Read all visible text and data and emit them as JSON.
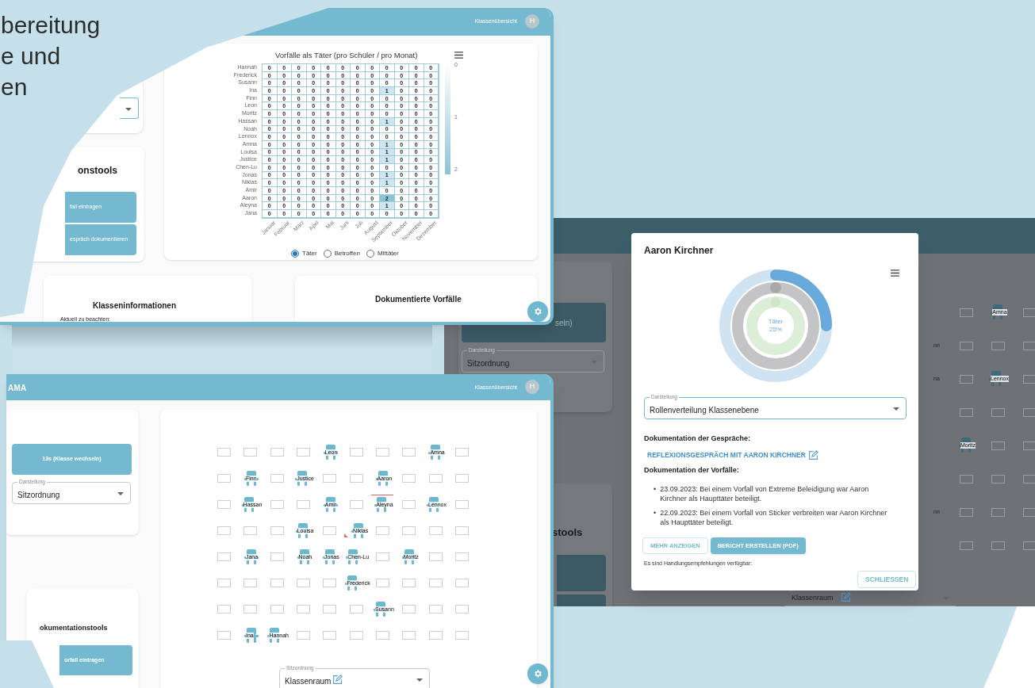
{
  "headline": {
    "lines": [
      "bereitung",
      "e und",
      "en"
    ]
  },
  "heatmap_window": {
    "header_link": "Klassenübersicht",
    "avatar": "H",
    "tools_card": {
      "title": "onstools",
      "buttons": [
        "fall eintragen",
        "espräch dokumentieren"
      ]
    },
    "chart": {
      "title": "Vorfälle als Täter (pro Schüler / pro Monat)",
      "months": [
        "Januar",
        "Februar",
        "März",
        "April",
        "Mai",
        "Juni",
        "Juli",
        "August",
        "September",
        "Oktober",
        "November",
        "Dezember"
      ],
      "scale": [
        "0",
        "1",
        "2"
      ],
      "rows": [
        {
          "name": "Hannah",
          "values": [
            "0",
            "0",
            "0",
            "0",
            "0",
            "0",
            "0",
            "0",
            "0",
            "0",
            "0",
            "0"
          ]
        },
        {
          "name": "Frederick",
          "values": [
            "0",
            "0",
            "0",
            "0",
            "0",
            "0",
            "0",
            "0",
            "0",
            "0",
            "0",
            "0"
          ]
        },
        {
          "name": "Susann",
          "values": [
            "0",
            "0",
            "0",
            "0",
            "0",
            "0",
            "0",
            "0",
            "0",
            "0",
            "0",
            "0"
          ]
        },
        {
          "name": "Ina",
          "values": [
            "0",
            "0",
            "0",
            "0",
            "0",
            "0",
            "0",
            "0",
            "1",
            "0",
            "0",
            "0"
          ]
        },
        {
          "name": "Finn",
          "values": [
            "0",
            "0",
            "0",
            "0",
            "0",
            "0",
            "0",
            "0",
            "0",
            "0",
            "0",
            "0"
          ]
        },
        {
          "name": "Leon",
          "values": [
            "0",
            "0",
            "0",
            "0",
            "0",
            "0",
            "0",
            "0",
            "0",
            "0",
            "0",
            "0"
          ]
        },
        {
          "name": "Moritz",
          "values": [
            "0",
            "0",
            "0",
            "0",
            "0",
            "0",
            "0",
            "0",
            "0",
            "0",
            "0",
            "0"
          ]
        },
        {
          "name": "Hassan",
          "values": [
            "0",
            "0",
            "0",
            "0",
            "0",
            "0",
            "0",
            "0",
            "1",
            "0",
            "0",
            "0"
          ]
        },
        {
          "name": "Noah",
          "values": [
            "0",
            "0",
            "0",
            "0",
            "0",
            "0",
            "0",
            "0",
            "0",
            "0",
            "0",
            "0"
          ]
        },
        {
          "name": "Lennox",
          "values": [
            "0",
            "0",
            "0",
            "0",
            "0",
            "0",
            "0",
            "0",
            "0",
            "0",
            "0",
            "0"
          ]
        },
        {
          "name": "Amna",
          "values": [
            "0",
            "0",
            "0",
            "0",
            "0",
            "0",
            "0",
            "0",
            "1",
            "0",
            "0",
            "0"
          ]
        },
        {
          "name": "Louisa",
          "values": [
            "0",
            "0",
            "0",
            "0",
            "0",
            "0",
            "0",
            "0",
            "1",
            "0",
            "0",
            "0"
          ]
        },
        {
          "name": "Justice",
          "values": [
            "0",
            "0",
            "0",
            "0",
            "0",
            "0",
            "0",
            "0",
            "1",
            "0",
            "0",
            "0"
          ]
        },
        {
          "name": "Chen-Lu",
          "values": [
            "0",
            "0",
            "0",
            "0",
            "0",
            "0",
            "0",
            "0",
            "0",
            "0",
            "0",
            "0"
          ]
        },
        {
          "name": "Jonas",
          "values": [
            "0",
            "0",
            "0",
            "0",
            "0",
            "0",
            "0",
            "0",
            "1",
            "0",
            "0",
            "0"
          ]
        },
        {
          "name": "Niklas",
          "values": [
            "0",
            "0",
            "0",
            "0",
            "0",
            "0",
            "0",
            "0",
            "1",
            "0",
            "0",
            "0"
          ]
        },
        {
          "name": "Amir",
          "values": [
            "0",
            "0",
            "0",
            "0",
            "0",
            "0",
            "0",
            "0",
            "0",
            "0",
            "0",
            "0"
          ]
        },
        {
          "name": "Aaron",
          "values": [
            "0",
            "0",
            "0",
            "0",
            "0",
            "0",
            "0",
            "0",
            "2",
            "0",
            "0",
            "0"
          ]
        },
        {
          "name": "Aleyna",
          "values": [
            "0",
            "0",
            "0",
            "0",
            "0",
            "0",
            "0",
            "0",
            "1",
            "0",
            "0",
            "0"
          ]
        },
        {
          "name": "Jana",
          "values": [
            "0",
            "0",
            "0",
            "0",
            "0",
            "0",
            "0",
            "0",
            "0",
            "0",
            "0",
            "0"
          ]
        }
      ]
    },
    "radios": [
      {
        "label": "Täter",
        "selected": true
      },
      {
        "label": "Betroffen",
        "selected": false
      },
      {
        "label": "Mittäter",
        "selected": false
      }
    ],
    "info_card": {
      "title": "Klasseninformationen",
      "text": "Aktuell zu beachten:"
    },
    "incidents_card": {
      "title": "Dokumentierte Vorfälle"
    }
  },
  "background_window": {
    "class_button": "seln)",
    "display_select": {
      "label": "Darstellung",
      "value": "Sitzordnung"
    },
    "tools_title": "stools",
    "seat_grid": [
      [
        {
          "kind": "gap"
        },
        {
          "kind": "empty"
        },
        {
          "kind": "seat",
          "name": "Amna"
        },
        {
          "kind": "empty"
        }
      ],
      [
        {
          "kind": "cut",
          "name": "nn"
        },
        {
          "kind": "empty"
        },
        {
          "kind": "empty"
        },
        {
          "kind": "empty"
        }
      ],
      [
        {
          "kind": "cut",
          "name": "na"
        },
        {
          "kind": "empty"
        },
        {
          "kind": "seat",
          "name": "Lennox"
        },
        {
          "kind": "empty"
        }
      ],
      [
        {
          "kind": "gap"
        },
        {
          "kind": "empty"
        },
        {
          "kind": "empty"
        },
        {
          "kind": "empty"
        }
      ],
      [
        {
          "kind": "gap"
        },
        {
          "kind": "seat",
          "name": "Moritz"
        },
        {
          "kind": "empty"
        },
        {
          "kind": "empty"
        }
      ],
      [
        {
          "kind": "gap"
        },
        {
          "kind": "empty"
        },
        {
          "kind": "empty"
        },
        {
          "kind": "empty"
        }
      ],
      [
        {
          "kind": "cut",
          "name": "nn"
        },
        {
          "kind": "empty"
        },
        {
          "kind": "empty"
        },
        {
          "kind": "empty"
        }
      ],
      [
        {
          "kind": "gap"
        },
        {
          "kind": "empty"
        },
        {
          "kind": "empty"
        },
        {
          "kind": "empty"
        }
      ]
    ],
    "room_select": {
      "value": "Klassenraum"
    }
  },
  "dialog": {
    "title": "Aaron Kirchner",
    "donut_center": [
      "Täter",
      "25%"
    ],
    "display_select": {
      "label": "Darstellung",
      "value": "Rollenverteilung Klassenebene"
    },
    "talks_heading": "Dokumentation der Gespräche:",
    "talk_link": "REFLEXIONSGESPRÄCH MIT AARON KIRCHNER",
    "incidents_heading": "Dokumentation der Vorfälle:",
    "incidents": [
      {
        "bullet": "•",
        "text": "23.09.2023: Bei einem Vorfall von Extreme Beleidigung war Aaron Kirchner als Haupttäter beteiligt."
      },
      {
        "bullet": "•",
        "text": "22.09.2023: Bei einem Vorfall von Sticker verbreiten war Aaron Kirchner als Haupttäter beteiligt."
      }
    ],
    "buttons": [
      {
        "label": "MEHR ANZEIGEN",
        "kind": "outlined"
      },
      {
        "label": "BERICHT ERSTELLEN (PDF)",
        "kind": "filled"
      }
    ],
    "note": "Es sind Handlungsempfehlungen verfügbar:",
    "close_button": "SCHLIESSEN"
  },
  "seating_window": {
    "brand": "AMA",
    "header_link": "Klassenübersicht",
    "avatar": "H",
    "class_button": "13s (Klasse wechseln)",
    "display_select": {
      "label": "Darstellung",
      "value": "Sitzordnung"
    },
    "tools_card": {
      "title": "okumentationstools",
      "buttons": [
        "orfall eintragen"
      ]
    },
    "seat_grid": [
      [
        {
          "kind": "empty"
        },
        {
          "kind": "empty"
        },
        {
          "kind": "empty"
        },
        {
          "kind": "empty"
        },
        {
          "kind": "seat",
          "name": "Leon"
        },
        {
          "kind": "empty"
        },
        {
          "kind": "empty"
        },
        {
          "kind": "empty"
        },
        {
          "kind": "seat",
          "name": "Amna"
        },
        {
          "kind": "empty"
        }
      ],
      [
        {
          "kind": "empty"
        },
        {
          "kind": "seat",
          "name": "Finn"
        },
        {
          "kind": "empty"
        },
        {
          "kind": "seat",
          "name": "Justice"
        },
        {
          "kind": "empty"
        },
        {
          "kind": "empty"
        },
        {
          "kind": "seat",
          "name": "Aaron"
        },
        {
          "kind": "empty"
        },
        {
          "kind": "empty"
        },
        {
          "kind": "empty"
        }
      ],
      [
        {
          "kind": "empty"
        },
        {
          "kind": "seat",
          "name": "Hassan"
        },
        {
          "kind": "empty"
        },
        {
          "kind": "empty"
        },
        {
          "kind": "seat",
          "name": "Amir"
        },
        {
          "kind": "empty"
        },
        {
          "kind": "seat",
          "name": "Aleyna",
          "marker": {
            "kind": "line"
          }
        },
        {
          "kind": "empty"
        },
        {
          "kind": "seat",
          "name": "Lennox"
        },
        {
          "kind": "empty"
        }
      ],
      [
        {
          "kind": "empty"
        },
        {
          "kind": "empty"
        },
        {
          "kind": "empty"
        },
        {
          "kind": "seat",
          "name": "Louisa"
        },
        {
          "kind": "empty"
        },
        {
          "kind": "seat",
          "name": "Niklas",
          "marker": {
            "kind": "corner"
          }
        },
        {
          "kind": "empty"
        },
        {
          "kind": "empty"
        },
        {
          "kind": "empty"
        },
        {
          "kind": "empty"
        }
      ],
      [
        {
          "kind": "empty"
        },
        {
          "kind": "seat",
          "name": "Jana"
        },
        {
          "kind": "empty"
        },
        {
          "kind": "seat",
          "name": "Noah"
        },
        {
          "kind": "seat",
          "name": "Jonas"
        },
        {
          "kind": "seat",
          "name": "Chen-Lu"
        },
        {
          "kind": "empty"
        },
        {
          "kind": "seat",
          "name": "Moritz"
        },
        {
          "kind": "empty"
        },
        {
          "kind": "empty"
        }
      ],
      [
        {
          "kind": "empty"
        },
        {
          "kind": "empty"
        },
        {
          "kind": "empty"
        },
        {
          "kind": "empty"
        },
        {
          "kind": "empty"
        },
        {
          "kind": "seat",
          "name": "Frederick"
        },
        {
          "kind": "empty"
        },
        {
          "kind": "empty"
        },
        {
          "kind": "empty"
        },
        {
          "kind": "empty"
        }
      ],
      [
        {
          "kind": "empty"
        },
        {
          "kind": "empty"
        },
        {
          "kind": "empty"
        },
        {
          "kind": "empty"
        },
        {
          "kind": "empty"
        },
        {
          "kind": "empty"
        },
        {
          "kind": "seat",
          "name": "Susann"
        },
        {
          "kind": "empty"
        },
        {
          "kind": "empty"
        },
        {
          "kind": "empty"
        }
      ],
      [
        {
          "kind": "empty"
        },
        {
          "kind": "seat",
          "name": "Ina"
        },
        {
          "kind": "seat",
          "name": "Hannah"
        },
        {
          "kind": "empty"
        },
        {
          "kind": "empty"
        },
        {
          "kind": "empty"
        },
        {
          "kind": "empty"
        },
        {
          "kind": "empty"
        },
        {
          "kind": "empty"
        },
        {
          "kind": "empty"
        }
      ]
    ],
    "room_select": {
      "label": "Sitzordnung",
      "value": "Klassenraum"
    }
  }
}
